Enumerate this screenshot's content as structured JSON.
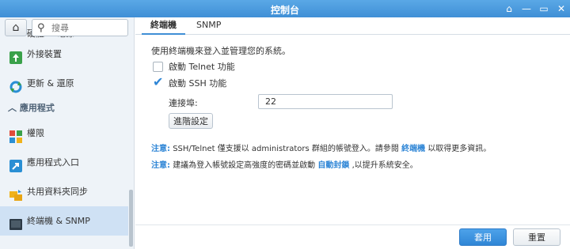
{
  "window": {
    "title": "控制台",
    "controls": [
      {
        "icon": "pin-icon",
        "glyph": "⌂"
      },
      {
        "icon": "minimize-icon",
        "glyph": "—"
      },
      {
        "icon": "maximize-icon",
        "glyph": "▭"
      },
      {
        "icon": "close-icon",
        "glyph": "✕"
      }
    ]
  },
  "sidebar": {
    "home_icon": "⌂",
    "search_placeholder": "搜尋",
    "items": [
      {
        "label": "硬體 & 電源",
        "icon": "power-icon",
        "color": "#f0b21b"
      },
      {
        "label": "外接裝置",
        "icon": "external-device-icon",
        "color": "#3aa14a"
      },
      {
        "label": "更新 & 還原",
        "icon": "update-restore-icon",
        "color": "#2a8fd4"
      },
      {
        "label": "應用程式",
        "section": true
      },
      {
        "label": "權限",
        "icon": "privileges-icon",
        "color": "#e04b3b"
      },
      {
        "label": "應用程式入口",
        "icon": "app-portal-icon",
        "color": "#2a8fd4"
      },
      {
        "label": "共用資料夾同步",
        "icon": "shared-folder-sync-icon",
        "color": "#f0b21b"
      },
      {
        "label": "終端機 & SNMP",
        "icon": "terminal-icon",
        "color": "#2d3a46",
        "active": true
      }
    ]
  },
  "tabs": [
    {
      "label": "終端機",
      "active": true
    },
    {
      "label": "SNMP",
      "active": false
    }
  ],
  "content": {
    "description": "使用終端機來登入並管理您的系統。",
    "telnet": {
      "label": "啟動 Telnet 功能",
      "checked": false
    },
    "ssh": {
      "label": "啟動 SSH 功能",
      "checked": true
    },
    "port_label": "連接埠:",
    "port_value": "22",
    "advanced_button": "進階設定",
    "note1": {
      "label": "注意:",
      "text": "SSH/Telnet 僅支援以 administrators 群組的帳號登入。請參閱",
      "link": "終端機",
      "suffix": "以取得更多資訊。"
    },
    "note2": {
      "label": "注意:",
      "text": "建議為登入帳號設定高強度的密碼並啟動",
      "link": "自動封鎖",
      "suffix": ",以提升系統安全。"
    }
  },
  "footer": {
    "apply": "套用",
    "reset": "重置"
  },
  "colors": {
    "accent": "#2f86d6",
    "titlebar": "#4a9ce0",
    "sidebar_bg": "#eef3f8",
    "sidebar_active": "#cfe1f4"
  }
}
